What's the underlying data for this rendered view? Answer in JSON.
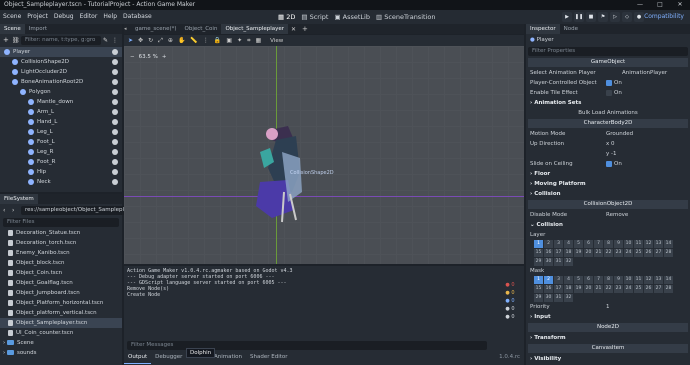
{
  "window": {
    "title": "Object_Sampleplayer.tscn - TutorialProject - Action Game Maker",
    "minimize": "—",
    "maximize": "□",
    "close": "✕"
  },
  "menu": [
    "Scene",
    "Project",
    "Debug",
    "Editor",
    "Help",
    "Database"
  ],
  "workspaces": [
    "2D",
    "Script",
    "AssetLib",
    "SceneTransition"
  ],
  "compatibility": "Compatibility",
  "scene_dock": {
    "tabs": [
      "Scene",
      "Import"
    ],
    "filter_placeholder": "Filter: name, t:type, g:gro",
    "nodes": [
      {
        "label": "Player",
        "depth": 0,
        "color": "#8fb4ff"
      },
      {
        "label": "CollisionShape2D",
        "depth": 1,
        "color": "#8fb4ff"
      },
      {
        "label": "LightOccluder2D",
        "depth": 1,
        "color": "#8fb4ff"
      },
      {
        "label": "BoneAnimationRoot2D",
        "depth": 1,
        "color": "#8fb4ff"
      },
      {
        "label": "Polygon",
        "depth": 2,
        "color": "#8fb4ff"
      },
      {
        "label": "Mantle_down",
        "depth": 3,
        "color": "#8fb4ff"
      },
      {
        "label": "Arm_L",
        "depth": 3,
        "color": "#8fb4ff"
      },
      {
        "label": "Hand_L",
        "depth": 3,
        "color": "#8fb4ff"
      },
      {
        "label": "Leg_L",
        "depth": 3,
        "color": "#8fb4ff"
      },
      {
        "label": "Foot_L",
        "depth": 3,
        "color": "#8fb4ff"
      },
      {
        "label": "Leg_R",
        "depth": 3,
        "color": "#8fb4ff"
      },
      {
        "label": "Foot_R",
        "depth": 3,
        "color": "#8fb4ff"
      },
      {
        "label": "Hip",
        "depth": 3,
        "color": "#8fb4ff"
      },
      {
        "label": "Neck",
        "depth": 3,
        "color": "#8fb4ff"
      }
    ]
  },
  "filesystem": {
    "tab": "FileSystem",
    "path": "res://sampleobject/Object_Sampleplaye",
    "filter_placeholder": "Filter Files",
    "files": [
      "Decoration_Statue.tscn",
      "Decoration_torch.tscn",
      "Enemy_Kanibo.tscn",
      "Object_block.tscn",
      "Object_Coin.tscn",
      "Object_Goalflag.tscn",
      "Object_Jumpboard.tscn",
      "Object_Platform_horizontal.tscn",
      "Object_platform_vertical.tscn",
      "Object_Sampleplayer.tscn",
      "UI_Coin_counter.tscn"
    ],
    "selected_index": 9,
    "folders": [
      "Scene",
      "sounds"
    ]
  },
  "editor_tabs": [
    "game_scene(*)",
    "Object_Coin",
    "Object_Sampleplayer"
  ],
  "viewport": {
    "zoom": "63.5 %",
    "view_label": "View",
    "node_overlay": "CollisionShape2D"
  },
  "output": {
    "lines": [
      "Action Game Maker v1.0.4.rc.agmaker based on Godot v4.3",
      "--- Debug adapter server started on port 6006 ---",
      "--- GDScript language server started on port 6005 ---",
      "Remove Node(s)",
      "Create Node"
    ],
    "filter_placeholder": "Filter Messages",
    "counts": [
      "0",
      "0",
      "0",
      "0",
      "0"
    ]
  },
  "bottom_tabs": [
    "Output",
    "Debugger",
    "Audio",
    "Animation",
    "Shader Editor"
  ],
  "tooltip": "Dolphin",
  "version": "1.0.4.rc",
  "inspector": {
    "tabs": [
      "Inspector",
      "Node"
    ],
    "node_name": "Player",
    "filter_placeholder": "Filter Properties",
    "gameobject_header": "GameObject",
    "select_anim_player_label": "Select Animation Player",
    "select_anim_player_value": "AnimationPlayer",
    "player_controlled_label": "Player-Controlled Object",
    "player_controlled_value": "On",
    "enable_tile_effect_label": "Enable Tile Effect",
    "enable_tile_effect_value": "On",
    "animation_sets": "Animation Sets",
    "bulk_load": "Bulk Load Animations",
    "characterbody_header": "CharacterBody2D",
    "motion_mode_label": "Motion Mode",
    "motion_mode_value": "Grounded",
    "up_direction_label": "Up Direction",
    "up_x": "0",
    "up_y": "-1",
    "slide_on_ceiling_label": "Slide on Ceiling",
    "slide_on_ceiling_value": "On",
    "floor": "Floor",
    "moving_platform": "Moving Platform",
    "collision": "Collision",
    "collisionobject_header": "CollisionObject2D",
    "disable_mode_label": "Disable Mode",
    "disable_mode_value": "Remove",
    "collision2": "Collision",
    "layer": "Layer",
    "mask": "Mask",
    "layer_numbers": [
      "1",
      "2",
      "3",
      "4",
      "5",
      "6",
      "7",
      "8",
      "9",
      "10",
      "11",
      "12",
      "13",
      "14",
      "15",
      "16",
      "17",
      "18",
      "19",
      "20",
      "21",
      "22",
      "23",
      "24",
      "25",
      "26",
      "27",
      "28",
      "29",
      "30",
      "31",
      "32"
    ],
    "layer_on": [
      1
    ],
    "mask_on": [
      1,
      2
    ],
    "priority_label": "Priority",
    "priority_value": "1",
    "input": "Input",
    "node2d_header": "Node2D",
    "transform": "Transform",
    "canvasitem_header": "CanvasItem",
    "visibility": "Visibility"
  },
  "colors": {
    "accent": "#4f8fde",
    "bg": "#1d2229",
    "panel": "#262c34",
    "viewport": "#4a4e54"
  }
}
